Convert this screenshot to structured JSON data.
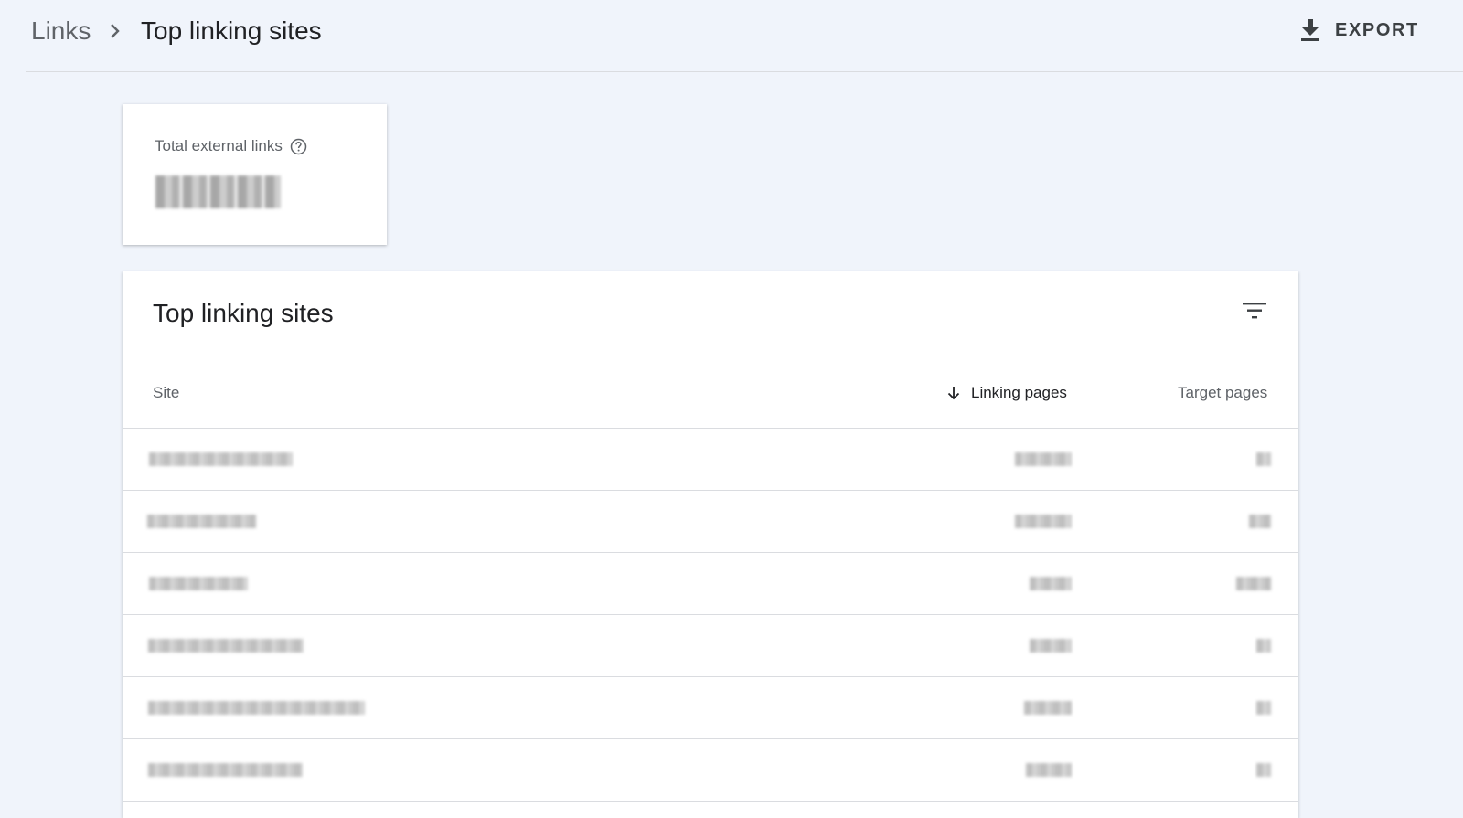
{
  "header": {
    "breadcrumb_parent": "Links",
    "breadcrumb_current": "Top linking sites",
    "export_label": "EXPORT"
  },
  "summary_card": {
    "label": "Total external links",
    "value": "redacted"
  },
  "table": {
    "title": "Top linking sites",
    "columns": {
      "site": "Site",
      "linking_pages": "Linking pages",
      "target_pages": "Target pages"
    },
    "sort": {
      "column": "linking_pages",
      "direction": "descending"
    },
    "rows": [
      {
        "site": "redacted",
        "linking_pages": "redacted",
        "target_pages": "redacted"
      },
      {
        "site": "redacted",
        "linking_pages": "redacted",
        "target_pages": "redacted"
      },
      {
        "site": "redacted",
        "linking_pages": "redacted",
        "target_pages": "redacted"
      },
      {
        "site": "redacted",
        "linking_pages": "redacted",
        "target_pages": "redacted"
      },
      {
        "site": "redacted",
        "linking_pages": "redacted",
        "target_pages": "redacted"
      },
      {
        "site": "redacted",
        "linking_pages": "redacted",
        "target_pages": "redacted"
      }
    ]
  },
  "icons": {
    "breadcrumb_separator": "chevron-right-icon",
    "export": "download-icon",
    "help": "help-circle-icon",
    "filter": "filter-list-icon",
    "sort": "arrow-down-icon"
  }
}
